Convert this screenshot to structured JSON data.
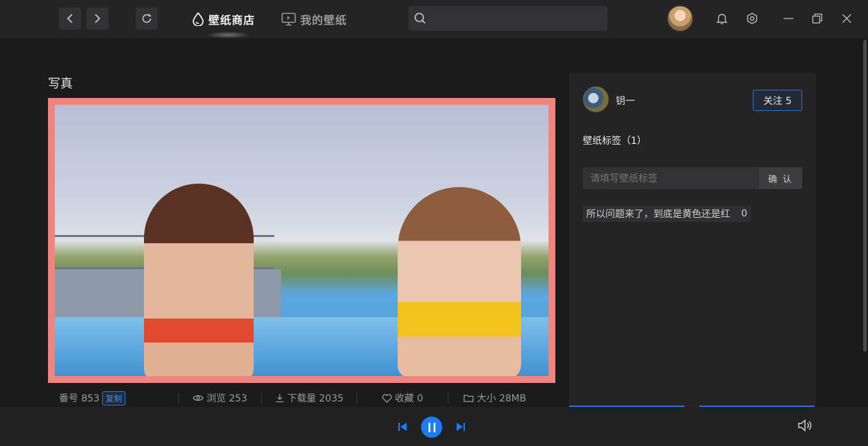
{
  "header": {
    "tabs": [
      {
        "label": "壁纸商店",
        "active": true
      },
      {
        "label": "我的壁纸",
        "active": false
      }
    ],
    "search": {
      "placeholder": "",
      "value": ""
    },
    "icons": [
      "back-icon",
      "forward-icon",
      "refresh-icon",
      "search-icon",
      "bell-icon",
      "settings-icon",
      "minimize-icon",
      "restore-icon",
      "close-icon"
    ]
  },
  "main": {
    "category_title": "写真",
    "stats": {
      "id_label": "番号 853",
      "copy_label": "复制",
      "views": "浏览 253",
      "downloads": "下载量 2035",
      "favorites": "收藏 0",
      "size": "大小 28MB"
    }
  },
  "panel": {
    "author_name": "钥一",
    "follow_label": "关注 5",
    "tags_title": "壁纸标签（1）",
    "tag_input_placeholder": "请填写壁纸标签",
    "confirm_label": "确 认",
    "tags": [
      {
        "text": "所以问题来了，到底是黄色还是红",
        "count": "0"
      }
    ]
  },
  "player": {
    "state": "playing",
    "icons": [
      "previous-icon",
      "pause-icon",
      "next-icon",
      "volume-icon"
    ]
  },
  "colors": {
    "accent": "#2d74d1",
    "play_button": "#1e7cf2",
    "frame": "#f0847f"
  }
}
